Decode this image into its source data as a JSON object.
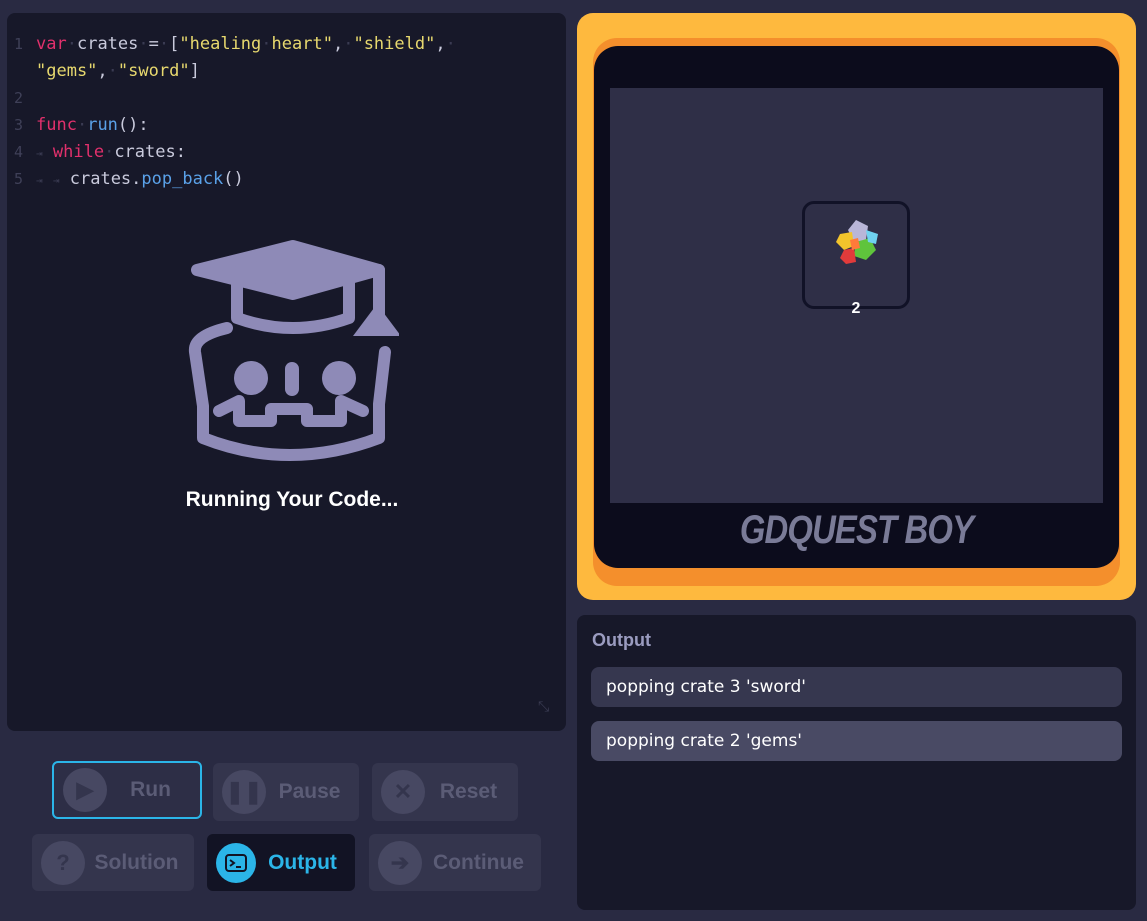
{
  "editor": {
    "lines": [
      {
        "num": "1",
        "tokens": [
          {
            "t": "var",
            "c": "kw"
          },
          {
            "t": "·",
            "c": "dot"
          },
          {
            "t": "crates",
            "c": ""
          },
          {
            "t": "·",
            "c": "dot"
          },
          {
            "t": "=",
            "c": ""
          },
          {
            "t": "·",
            "c": "dot"
          },
          {
            "t": "[",
            "c": ""
          },
          {
            "t": "\"healing",
            "c": "str"
          },
          {
            "t": "·",
            "c": "dot"
          },
          {
            "t": "heart\"",
            "c": "str"
          },
          {
            "t": ",",
            "c": ""
          },
          {
            "t": "·",
            "c": "dot"
          },
          {
            "t": "\"shield\"",
            "c": "str"
          },
          {
            "t": ",",
            "c": ""
          },
          {
            "t": "·",
            "c": "dot"
          }
        ]
      },
      {
        "num": "",
        "tokens": [
          {
            "t": "\"gems\"",
            "c": "str"
          },
          {
            "t": ",",
            "c": ""
          },
          {
            "t": "·",
            "c": "dot"
          },
          {
            "t": "\"sword\"",
            "c": "str"
          },
          {
            "t": "]",
            "c": ""
          }
        ]
      },
      {
        "num": "2",
        "tokens": []
      },
      {
        "num": "3",
        "tokens": [
          {
            "t": "func",
            "c": "kw"
          },
          {
            "t": "·",
            "c": "dot"
          },
          {
            "t": "run",
            "c": "fn"
          },
          {
            "t": "():",
            "c": ""
          }
        ]
      },
      {
        "num": "4",
        "tokens": [
          {
            "t": "⇥",
            "c": "tab"
          },
          {
            "t": "    ",
            "c": ""
          },
          {
            "t": "while",
            "c": "kw"
          },
          {
            "t": "·",
            "c": "dot"
          },
          {
            "t": "crates:",
            "c": ""
          }
        ]
      },
      {
        "num": "5",
        "tokens": [
          {
            "t": "⇥",
            "c": "tab"
          },
          {
            "t": "    ",
            "c": ""
          },
          {
            "t": "⇥",
            "c": "tab"
          },
          {
            "t": "    ",
            "c": ""
          },
          {
            "t": "crates.",
            "c": ""
          },
          {
            "t": "pop_back",
            "c": "fn"
          },
          {
            "t": "()",
            "c": ""
          }
        ]
      }
    ],
    "status": "Running Your Code..."
  },
  "buttons": {
    "run": "Run",
    "pause": "Pause",
    "reset": "Reset",
    "solution": "Solution",
    "output": "Output",
    "continue": "Continue"
  },
  "game": {
    "crate_count": "2",
    "brand": "GDQUEST BOY"
  },
  "output": {
    "title": "Output",
    "lines": [
      "popping crate 3 'sword'",
      "popping crate 2 'gems'"
    ]
  },
  "colors": {
    "accent": "#2bb5e8",
    "keyword": "#e1306c",
    "string": "#e7d86e",
    "function": "#5aa1e8",
    "console": "#feb93e"
  }
}
